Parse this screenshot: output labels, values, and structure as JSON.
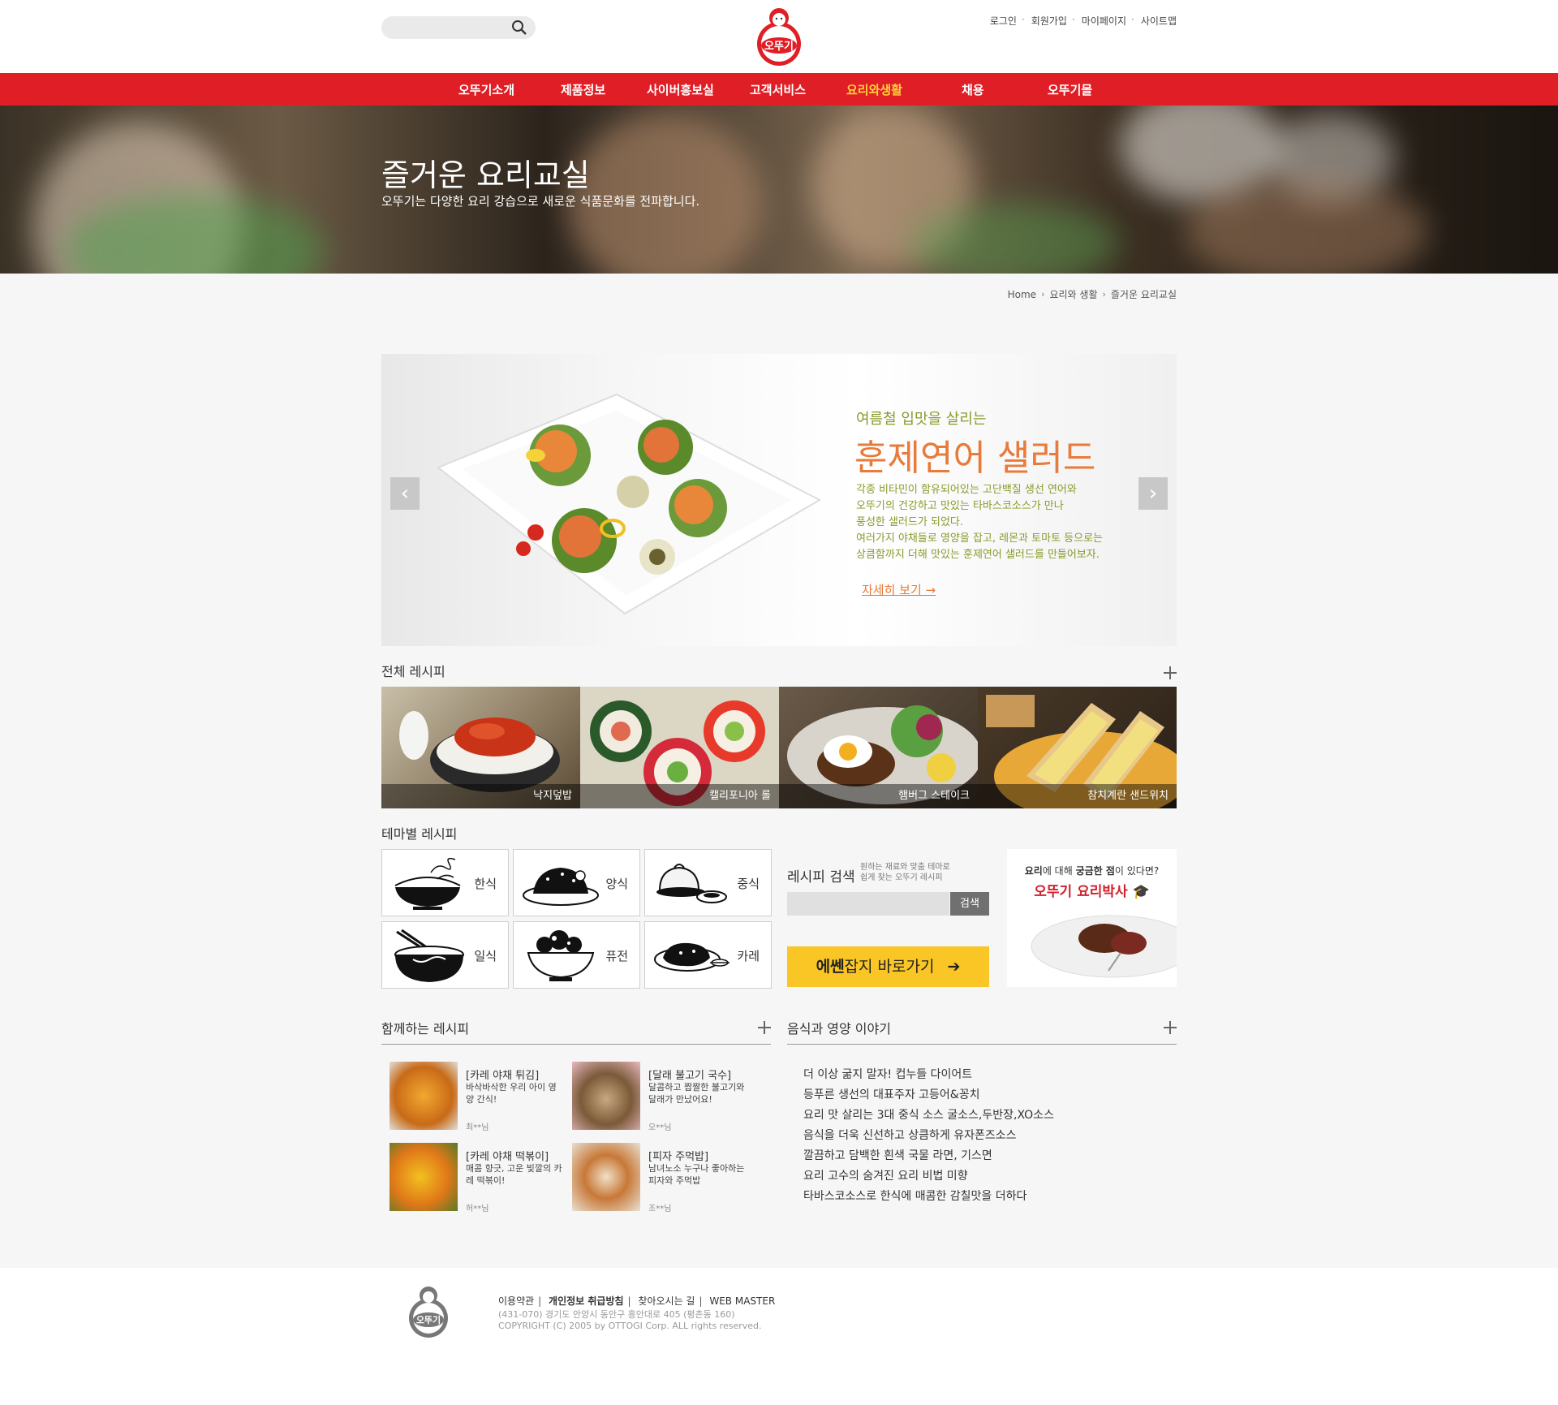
{
  "header": {
    "search_placeholder": "",
    "logo_text": "오뚜기",
    "util_links": [
      "로그인",
      "회원가입",
      "마이페이지",
      "사이트맵"
    ]
  },
  "nav": {
    "items": [
      "오뚜기소개",
      "제품정보",
      "사이버홍보실",
      "고객서비스",
      "요리와생활",
      "채용",
      "오뚜기몰"
    ],
    "active": "요리와생활",
    "bg_color": "#e01e26",
    "active_color": "#ffd23a"
  },
  "hero": {
    "title": "즐거운 요리교실",
    "subtitle": "오뚜기는 다양한 요리 강습으로 새로운 식품문화를 전파합니다."
  },
  "breadcrumb": [
    "Home",
    "요리와 생활",
    "즐거운 요리교실"
  ],
  "slide": {
    "subtitle": "여름철 입맛을 살리는",
    "title": "훈제연어 샐러드",
    "desc": [
      "각종 비타민이 함유되어있는 고단백질 생선 연어와",
      "오뚜기의 건강하고 맛있는 타바스코소스가 만나",
      "풍성한 샐러드가 되었다.",
      "여러가지 야채들로 영양을 잡고, 레몬과 토마토 등으로는",
      "상큼함까지 더해 맛있는 훈제연어 샐러드를 만들어보자."
    ],
    "more": "자세히 보기 →",
    "accent_color": "#e87a3a",
    "text_color": "#8a9a2a"
  },
  "all_recipes": {
    "title": "전체 레시피",
    "items": [
      "낙지덮밥",
      "캘리포니아 롤",
      "햄버그 스테이크",
      "참치계란 샌드위치"
    ]
  },
  "theme": {
    "title": "테마별 레시피",
    "items": [
      "한식",
      "양식",
      "중식",
      "일식",
      "퓨전",
      "카레"
    ]
  },
  "recipe_search": {
    "title": "레시피 검색",
    "desc": [
      "원하는 재료와 맞춤 테마로",
      "쉽게 찾는 오뚜기 레시피"
    ],
    "button": "검색",
    "essen_bold": "에쎈",
    "essen_rest": "잡지 바로가기"
  },
  "doctor": {
    "question_a": "요리",
    "question_b": "에 대해 ",
    "question_c": "궁금한 점",
    "question_d": "이 있다면?",
    "title": "오뚜기 요리박사"
  },
  "together": {
    "title": "함께하는 레시피",
    "items": [
      {
        "title": "[카레 야채 튀김]",
        "desc": "바삭바삭한 우리 아이 영양 간식!",
        "author": "최**님"
      },
      {
        "title": "[달래 불고기 국수]",
        "desc": "달콤하고 짭짤한 불고기와 달래가 만났어요!",
        "author": "오**님"
      },
      {
        "title": "[카레 야채 떡볶이]",
        "desc": "매콤 향긋, 고운 빛깔의 카레 떡볶이!",
        "author": "허**님"
      },
      {
        "title": "[피자 주먹밥]",
        "desc": "남녀노소 누구나 좋아하는 피자와 주먹밥",
        "author": "조**님"
      }
    ]
  },
  "story": {
    "title": "음식과 영양 이야기",
    "items": [
      "더 이상 굶지 말자! 컵누들 다이어트",
      "등푸른 생선의 대표주자 고등어&꽁치",
      "요리 맛 살리는 3대 중식 소스 굴소스,두반장,XO소스",
      "음식을 더욱 신선하고 상큼하게 유자폰즈소스",
      "깔끔하고 담백한 흰색 국물 라면, 기스면",
      "요리 고수의 숨겨진 요리 비법 미향",
      "타바스코소스로 한식에 매콤한 감칠맛을 더하다"
    ]
  },
  "footer": {
    "links": [
      "이용약관",
      "개인정보 취급방침",
      "찾아오시는 길",
      "WEB MASTER"
    ],
    "address": "(431-070) 경기도 안양시 동안구 흥안대로 405 (평촌동 160)",
    "copyright": "COPYRIGHT (C) 2005 by OTTOGI Corp. ALL rights reserved."
  }
}
